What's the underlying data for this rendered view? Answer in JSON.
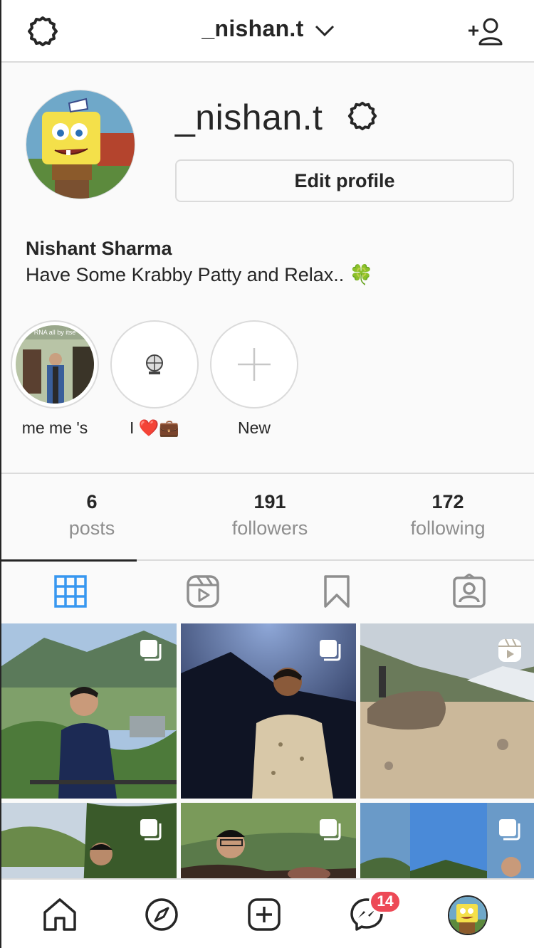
{
  "header": {
    "username": "_nishan.t",
    "settings_icon": "gear-icon",
    "dropdown_icon": "chevron-down-icon",
    "add_user_icon": "add-user-icon"
  },
  "profile": {
    "username": "_nishan.t",
    "edit_label": "Edit profile",
    "full_name": "Nishant Sharma",
    "bio": "Have Some Krabby Patty and Relax.. 🍀"
  },
  "highlights": [
    {
      "label": "me me 's",
      "caption_fragment": "RNA all by itse"
    },
    {
      "label": "I ❤️💼"
    },
    {
      "label": "New"
    }
  ],
  "stats": [
    {
      "value": "6",
      "label": "posts"
    },
    {
      "value": "191",
      "label": "followers"
    },
    {
      "value": "172",
      "label": "following"
    }
  ],
  "tabs": [
    {
      "name": "grid",
      "icon": "grid-icon",
      "active": true
    },
    {
      "name": "reels",
      "icon": "reels-icon",
      "active": false
    },
    {
      "name": "saved",
      "icon": "bookmark-icon",
      "active": false
    },
    {
      "name": "tagged",
      "icon": "tagged-icon",
      "active": false
    }
  ],
  "posts": [
    {
      "type": "carousel"
    },
    {
      "type": "carousel"
    },
    {
      "type": "reel"
    },
    {
      "type": "carousel"
    },
    {
      "type": "carousel"
    },
    {
      "type": "carousel"
    }
  ],
  "bottom_nav": {
    "messages_badge": "14",
    "items": [
      "home-icon",
      "explore-icon",
      "new-post-icon",
      "messenger-icon",
      "profile-avatar"
    ]
  },
  "colors": {
    "accent": "#3897f0",
    "badge": "#ed4956",
    "text": "#262626",
    "muted": "#8e8e8e",
    "border": "#dbdbdb"
  }
}
